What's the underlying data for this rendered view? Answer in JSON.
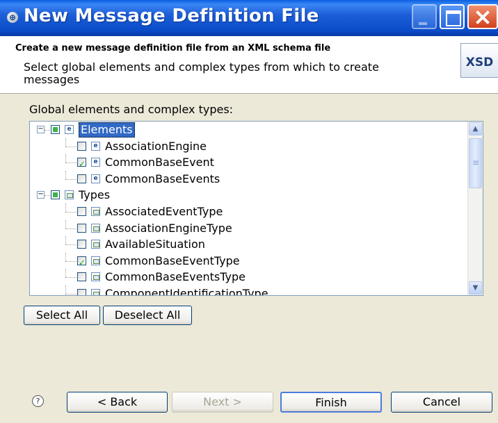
{
  "window": {
    "title": "New Message Definition File",
    "title_icon": "globe-icon"
  },
  "banner": {
    "heading": "Create a new message definition file from an XML schema file",
    "description": "Select global elements and complex types from which to create messages",
    "logo_text": "XSD"
  },
  "tree_label": "Global elements and complex types:",
  "tree": [
    {
      "label": "Elements",
      "depth": 0,
      "state": "grayed",
      "expanded": true,
      "selected": true,
      "icon": "element-icon"
    },
    {
      "label": "AssociationEngine",
      "depth": 1,
      "state": "unchecked",
      "icon": "element-icon"
    },
    {
      "label": "CommonBaseEvent",
      "depth": 1,
      "state": "checked",
      "icon": "element-icon"
    },
    {
      "label": "CommonBaseEvents",
      "depth": 1,
      "state": "unchecked",
      "icon": "element-icon"
    },
    {
      "label": "Types",
      "depth": 0,
      "state": "grayed",
      "expanded": true,
      "icon": "type-icon"
    },
    {
      "label": "AssociatedEventType",
      "depth": 1,
      "state": "unchecked",
      "icon": "type-icon"
    },
    {
      "label": "AssociationEngineType",
      "depth": 1,
      "state": "unchecked",
      "icon": "type-icon"
    },
    {
      "label": "AvailableSituation",
      "depth": 1,
      "state": "unchecked",
      "icon": "type-icon"
    },
    {
      "label": "CommonBaseEventType",
      "depth": 1,
      "state": "checked",
      "icon": "type-icon"
    },
    {
      "label": "CommonBaseEventsType",
      "depth": 1,
      "state": "unchecked",
      "icon": "type-icon"
    },
    {
      "label": "ComponentIdentificationType",
      "depth": 1,
      "state": "unchecked",
      "icon": "type-icon"
    }
  ],
  "buttons": {
    "select_all": "Select All",
    "deselect_all": "Deselect All",
    "back": "< Back",
    "next": "Next >",
    "finish": "Finish",
    "cancel": "Cancel",
    "help": "?"
  },
  "colors": {
    "titlebar": "#1d5fd8",
    "selection": "#316ac5",
    "dialog_bg": "#ece9d8"
  }
}
